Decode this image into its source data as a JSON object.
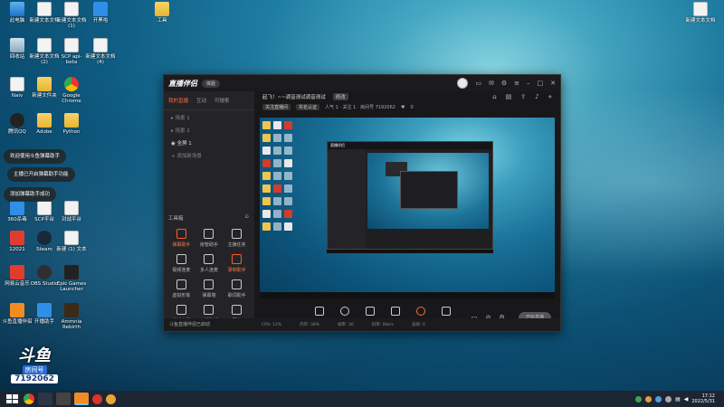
{
  "desktop": {
    "icons": [
      {
        "label": "此电脑",
        "icon": "pc"
      },
      {
        "label": "新建文本文档",
        "icon": "doc"
      },
      {
        "label": "新建文本文档 (1)",
        "icon": "doc"
      },
      {
        "label": "开黑啦",
        "icon": "blue"
      },
      {
        "label": "回收站",
        "icon": "bin"
      },
      {
        "label": "新建文本文档 (2)",
        "icon": "doc"
      },
      {
        "label": "SCP api-beta",
        "icon": "doc"
      },
      {
        "label": "新建文本文档 (4)",
        "icon": "doc"
      },
      {
        "label": "Naiv",
        "icon": "doc"
      },
      {
        "label": "新建文件夹",
        "icon": "folder"
      },
      {
        "label": "Google Chrome",
        "icon": "chrome"
      },
      {
        "label": "腾讯QQ",
        "icon": "qq"
      },
      {
        "label": "Adobe",
        "icon": "folder"
      },
      {
        "label": "Python",
        "icon": "folder"
      },
      {
        "label": "360杀毒",
        "icon": "blue"
      },
      {
        "label": "SCP平台",
        "icon": "doc"
      },
      {
        "label": "对战平台",
        "icon": "doc"
      },
      {
        "label": "12021",
        "icon": "red"
      },
      {
        "label": "Steam",
        "icon": "steam"
      },
      {
        "label": "新建 (1) 文本",
        "icon": "doc"
      },
      {
        "label": "网易云音乐",
        "icon": "red"
      },
      {
        "label": "OBS Studio",
        "icon": "obs"
      },
      {
        "label": "Epic Games Launcher",
        "icon": "dark"
      },
      {
        "label": "斗鱼直播伴侣",
        "icon": "orange"
      },
      {
        "label": "开播助手",
        "icon": "blue"
      },
      {
        "label": "Ammnia Rebirth",
        "icon": "game"
      },
      {
        "label": "工具",
        "icon": "folder"
      },
      {
        "label": "新建文本文档",
        "icon": "doc"
      }
    ],
    "toasts": [
      "欢迎使用斗鱼弹幕助手",
      "主播已开启弹幕助手功能",
      "添加弹幕助手成功"
    ],
    "watermark": {
      "line1": "斗鱼",
      "room_label": "房间号",
      "room_number": "7192062"
    }
  },
  "app": {
    "title": "直播伴侣",
    "edition_button": "体验",
    "left_tabs": [
      "我的直播",
      "互动",
      "可搜索"
    ],
    "scenes": [
      "场景 1",
      "场景 2",
      "全屏 1",
      "添加新场景"
    ],
    "tools_title": "工具箱",
    "tools": [
      {
        "label": "弹幕助手",
        "icon": "danmu-icon",
        "hot": true
      },
      {
        "label": "房管助手",
        "icon": "user-icon",
        "hot": false
      },
      {
        "label": "主播任务",
        "icon": "task-icon",
        "hot": false
      },
      {
        "label": "视频连麦",
        "icon": "camera-icon",
        "hot": false
      },
      {
        "label": "多人连麦",
        "icon": "users-icon",
        "hot": false
      },
      {
        "label": "录制助手",
        "icon": "record-icon",
        "hot": true
      },
      {
        "label": "虚拟形象",
        "icon": "avatar-icon",
        "hot": false
      },
      {
        "label": "弹幕墙",
        "icon": "wall-icon",
        "hot": false
      },
      {
        "label": "歌词助手",
        "icon": "lyrics-icon",
        "hot": false
      },
      {
        "label": "游戏直播",
        "icon": "game-icon",
        "hot": false
      },
      {
        "label": "开播助手",
        "icon": "start-icon",
        "hot": false
      },
      {
        "label": "更多",
        "icon": "more-icon",
        "hot": false
      }
    ],
    "left_footer": "斗鱼直播伴侣已启动",
    "room_title": "起飞！~~调音测试调音测试",
    "room_tag": "修改",
    "room_chips": [
      "关注直播间",
      "实名认证"
    ],
    "room_stats": "人气 1  ·  关注 1  ·  房间号 7192062",
    "like_count": "0",
    "controls": [
      {
        "label": "直播屏幕",
        "icon": "screen-icon"
      },
      {
        "label": "摄像头",
        "icon": "webcam-icon"
      },
      {
        "label": "手机投屏",
        "icon": "phone-icon"
      },
      {
        "label": "多媒体",
        "icon": "media-icon"
      },
      {
        "label": "麦克风",
        "icon": "mic-icon"
      },
      {
        "label": "扬声器",
        "icon": "speaker-icon"
      }
    ],
    "go_live_button": "开始直播",
    "status_items": [
      "CPU: 12%",
      "内存: 38%",
      "帧率: 30",
      "码率: 0kb/s",
      "丢帧: 0"
    ]
  },
  "taskbar": {
    "time": "17:12",
    "date": "2022/5/31"
  },
  "colors": {
    "accent": "#ff6b3d",
    "app_bg": "#1f1f22"
  }
}
